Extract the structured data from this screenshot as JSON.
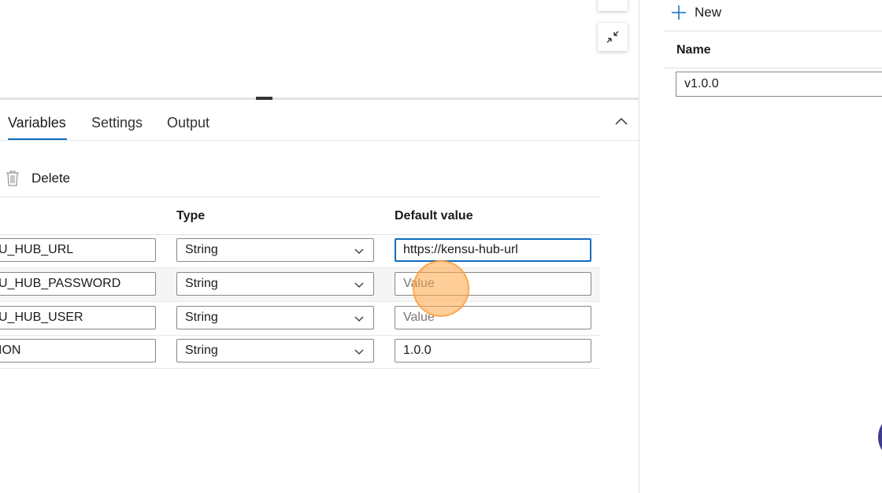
{
  "tabs": [
    {
      "label": "Variables",
      "active": true
    },
    {
      "label": "Settings",
      "active": false
    },
    {
      "label": "Output",
      "active": false
    }
  ],
  "toolbar": {
    "delete_label": "Delete"
  },
  "table": {
    "headers": {
      "type": "Type",
      "default": "Default value"
    },
    "rows": [
      {
        "name": "U_HUB_URL",
        "type": "String",
        "value": "https://kensu-hub-url",
        "placeholder": "Value"
      },
      {
        "name": "U_HUB_PASSWORD",
        "type": "String",
        "value": "",
        "placeholder": "Value"
      },
      {
        "name": "U_HUB_USER",
        "type": "String",
        "value": "",
        "placeholder": "Value"
      },
      {
        "name": "ION",
        "type": "String",
        "value": "1.0.0",
        "placeholder": "Value"
      }
    ]
  },
  "right_panel": {
    "new_label": "New",
    "name_header": "Name",
    "name_value": "v1.0.0"
  },
  "colors": {
    "accent": "#0f6cbd",
    "click_indicator": "#ffa546"
  }
}
